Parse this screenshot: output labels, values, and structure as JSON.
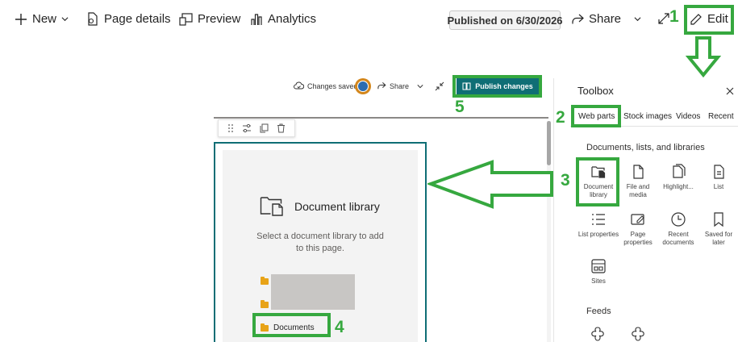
{
  "top_bar": {
    "new_label": "New",
    "page_details_label": "Page details",
    "preview_label": "Preview",
    "analytics_label": "Analytics",
    "published_label": "Published on 6/30/2026",
    "share_label": "Share",
    "edit_label": "Edit"
  },
  "edit_bar": {
    "changes_saved": "Changes saved",
    "share_label": "Share",
    "publish_label": "Publish changes"
  },
  "web_part": {
    "title": "Document library",
    "description": "Select a document library to add to this page.",
    "selected_folder": "Documents"
  },
  "toolbox": {
    "title": "Toolbox",
    "tabs": [
      "Web parts",
      "Stock images",
      "Videos",
      "Recent"
    ],
    "section_title": "Documents, lists, and libraries",
    "items": [
      {
        "label": "Document library",
        "icon": "document-library-icon"
      },
      {
        "label": "File and media",
        "icon": "file-icon"
      },
      {
        "label": "Highlight...",
        "icon": "highlight-icon"
      },
      {
        "label": "List",
        "icon": "list-icon"
      },
      {
        "label": "List properties",
        "icon": "list-properties-icon"
      },
      {
        "label": "Page properties",
        "icon": "page-properties-icon"
      },
      {
        "label": "Recent documents",
        "icon": "clock-icon"
      },
      {
        "label": "Saved for later",
        "icon": "bookmark-icon"
      },
      {
        "label": "Sites",
        "icon": "sites-icon"
      }
    ],
    "feeds_title": "Feeds"
  },
  "annotations": {
    "step1": "1",
    "step2": "2",
    "step3": "3",
    "step4": "4",
    "step5": "5",
    "color": "#36a83f"
  },
  "colors": {
    "accent": "#0f6e75",
    "annotation": "#36a83f"
  }
}
